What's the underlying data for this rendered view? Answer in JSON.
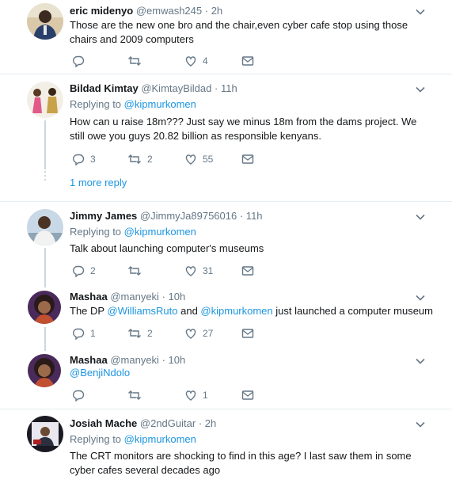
{
  "tweets": [
    {
      "name": "eric midenyo",
      "handle": "@emwash245",
      "time": "· 2h",
      "text": "Those are the new one bro and the chair,even cyber cafe stop using those chairs and 2009 computers",
      "replies": "",
      "retweets": "",
      "likes": "4"
    },
    {
      "name": "Bildad Kimtay",
      "handle": "@KimtayBildad",
      "time": "· 11h",
      "replying_label": "Replying to",
      "replying_to": "@kipmurkomen",
      "text": "How can u raise 18m??? Just say we minus 18m from the dams project. We still owe you guys 20.82 billion as responsible kenyans.",
      "replies": "3",
      "retweets": "2",
      "likes": "55",
      "more_replies": "1 more reply"
    },
    {
      "name": "Jimmy James",
      "handle": "@JimmyJa89756016",
      "time": "· 11h",
      "replying_label": "Replying to",
      "replying_to": "@kipmurkomen",
      "text": "Talk about launching computer's museums",
      "replies": "2",
      "retweets": "",
      "likes": "31"
    },
    {
      "name": "Mashaa",
      "handle": "@manyeki",
      "time": "· 10h",
      "text_prefix": "The DP ",
      "mention1": "@WilliamsRuto",
      "text_middle": " and ",
      "mention2": "@kipmurkomen",
      "text_suffix": " just launched a computer museum",
      "replies": "1",
      "retweets": "2",
      "likes": "27"
    },
    {
      "name": "Mashaa",
      "handle": "@manyeki",
      "time": "· 10h",
      "mention": "@BenjiNdolo",
      "replies": "",
      "retweets": "",
      "likes": "1"
    },
    {
      "name": "Josiah Mache",
      "handle": "@2ndGuitar",
      "time": "· 2h",
      "replying_label": "Replying to",
      "replying_to": "@kipmurkomen",
      "text": "The CRT monitors are shocking to find in this age? I last saw them in some cyber cafes several decades ago"
    }
  ],
  "colors": {
    "link": "#1b95e0",
    "meta": "#657786",
    "divider": "#e6ecf0",
    "thread": "#ccd6dd"
  },
  "icons": [
    "reply-icon",
    "retweet-icon",
    "like-icon",
    "direct-message-icon",
    "chevron-down-icon"
  ]
}
